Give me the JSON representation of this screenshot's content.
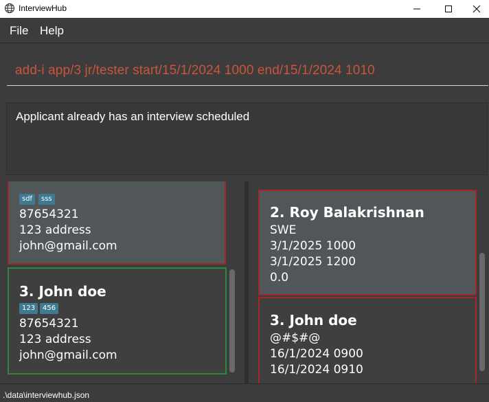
{
  "window": {
    "title": "InterviewHub",
    "icon": "globe-icon"
  },
  "menu": {
    "file": "File",
    "help": "Help"
  },
  "command": {
    "text": "add-i app/3 jr/tester start/15/1/2024 1000 end/15/1/2024 1010",
    "color": "#c8553d"
  },
  "result": {
    "message": "Applicant already has an interview scheduled"
  },
  "applicants": [
    {
      "title": "",
      "tags": [
        "sdf",
        "sss"
      ],
      "phone": "87654321",
      "address": "123 address",
      "email": "john@gmail.com",
      "border": "#a02828"
    },
    {
      "title": "3.  John doe",
      "tags": [
        "123",
        "456"
      ],
      "phone": "87654321",
      "address": "123 address",
      "email": "john@gmail.com",
      "border": "#2a8a3a"
    }
  ],
  "interviews": [
    {
      "title": "2.  Roy Balakrishnan",
      "role": "SWE",
      "start": "3/1/2025 1000",
      "end": "3/1/2025 1200",
      "rating": "0.0",
      "border": "#a02828"
    },
    {
      "title": "3.  John doe",
      "role": "@#$#@",
      "start": "16/1/2024 0900",
      "end": "16/1/2024 0910",
      "border": "#a02828"
    }
  ],
  "status": {
    "path": ".\\data\\interviewhub.json"
  }
}
